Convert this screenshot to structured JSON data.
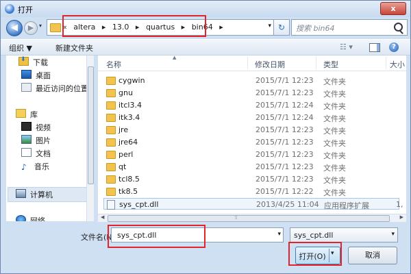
{
  "window": {
    "title": "打开",
    "close_glyph": "x"
  },
  "nav": {
    "back_glyph": "◀",
    "forward_glyph": "▶",
    "breadcrumbs": [
      "«",
      "altera",
      "▸",
      "13.0",
      "▸",
      "quartus",
      "▸",
      "bin64",
      "▸"
    ],
    "refresh_glyph": "↻",
    "search_placeholder": "搜索 bin64"
  },
  "toolbar": {
    "organize": "组织 ▼",
    "new_folder": "新建文件夹",
    "views_glyph": "☷ ▾",
    "help_glyph": "?"
  },
  "sidebar": {
    "items": [
      {
        "label": "下载",
        "icon": "download-folder-icon"
      },
      {
        "label": "桌面",
        "icon": "desktop-icon"
      },
      {
        "label": "最近访问的位置",
        "icon": "recent-places-icon"
      },
      {
        "label": "库",
        "icon": "libraries-icon"
      },
      {
        "label": "视频",
        "icon": "videos-icon"
      },
      {
        "label": "图片",
        "icon": "pictures-icon"
      },
      {
        "label": "文档",
        "icon": "documents-icon"
      },
      {
        "label": "音乐",
        "icon": "music-icon"
      },
      {
        "label": "计算机",
        "icon": "computer-icon"
      },
      {
        "label": "网络",
        "icon": "network-icon"
      }
    ]
  },
  "columns": {
    "name": "名称",
    "date": "修改日期",
    "type": "类型",
    "size": "大小"
  },
  "files": [
    {
      "name": "cygwin",
      "date": "2015/7/1 12:23",
      "type": "文件夹",
      "size": ""
    },
    {
      "name": "gnu",
      "date": "2015/7/1 12:23",
      "type": "文件夹",
      "size": ""
    },
    {
      "name": "itcl3.4",
      "date": "2015/7/1 12:24",
      "type": "文件夹",
      "size": ""
    },
    {
      "name": "itk3.4",
      "date": "2015/7/1 12:24",
      "type": "文件夹",
      "size": ""
    },
    {
      "name": "jre",
      "date": "2015/7/1 12:23",
      "type": "文件夹",
      "size": ""
    },
    {
      "name": "jre64",
      "date": "2015/7/1 12:23",
      "type": "文件夹",
      "size": ""
    },
    {
      "name": "perl",
      "date": "2015/7/1 12:23",
      "type": "文件夹",
      "size": ""
    },
    {
      "name": "qt",
      "date": "2015/7/1 12:23",
      "type": "文件夹",
      "size": ""
    },
    {
      "name": "tcl8.5",
      "date": "2015/7/1 12:23",
      "type": "文件夹",
      "size": ""
    },
    {
      "name": "tk8.5",
      "date": "2015/7/1 12:22",
      "type": "文件夹",
      "size": ""
    },
    {
      "name": "sys_cpt.dll",
      "date": "2013/4/25 11:04",
      "type": "应用程序扩展",
      "size": "1,"
    }
  ],
  "footer": {
    "filename_label": "文件名(N):",
    "filename_value": "sys_cpt.dll",
    "filetype_value": "sys_cpt.dll",
    "open_label": "打开(O)",
    "cancel_label": "取消",
    "dropdown_glyph": "▾"
  },
  "colors": {
    "highlight": "#e2242a",
    "selection": "#eef5fd",
    "folder": "#f3c350"
  }
}
